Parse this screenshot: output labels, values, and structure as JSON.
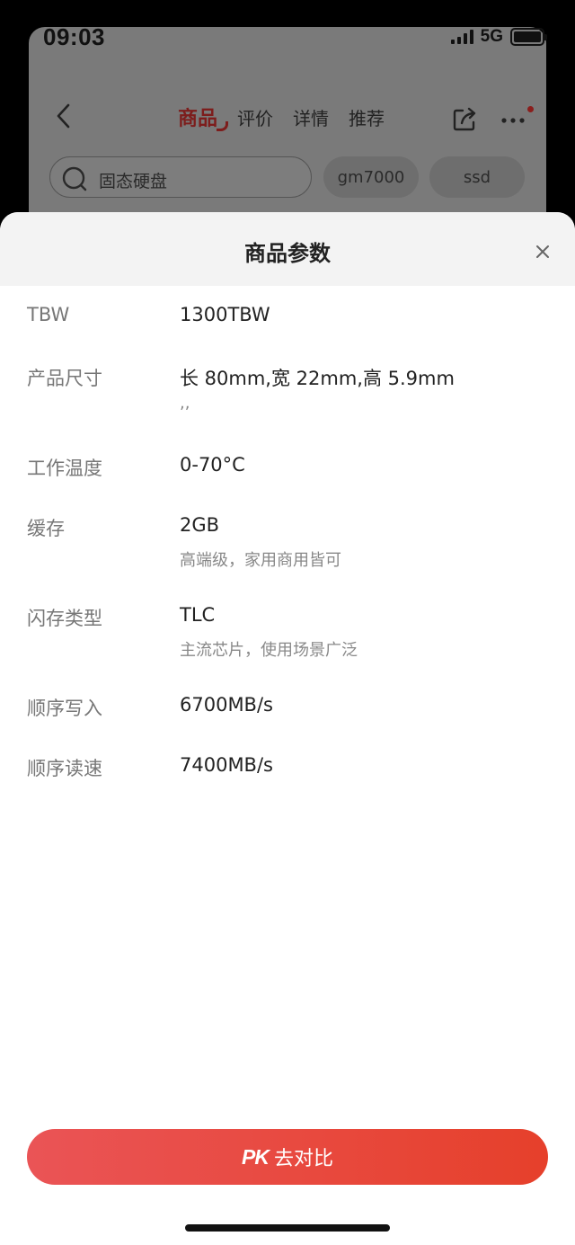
{
  "status_bar": {
    "time": "09:03",
    "network": "5G"
  },
  "background_page": {
    "tabs": [
      {
        "label": "商品",
        "active": true
      },
      {
        "label": "评价",
        "active": false
      },
      {
        "label": "详情",
        "active": false
      },
      {
        "label": "推荐",
        "active": false
      }
    ],
    "search": {
      "text": "固态硬盘"
    },
    "chips": [
      "gm7000",
      "ssd"
    ],
    "accent_color": "#7d1d1c"
  },
  "sheet": {
    "title": "商品参数",
    "params": [
      {
        "label": "TBW",
        "value": "1300TBW",
        "desc": ""
      },
      {
        "label": "产品尺寸",
        "value": "长 80mm,宽 22mm,高 5.9mm",
        "desc": ",,"
      },
      {
        "label": "工作温度",
        "value": "0-70°C",
        "desc": ""
      },
      {
        "label": "缓存",
        "value": "2GB",
        "desc": "高端级，家用商用皆可"
      },
      {
        "label": "闪存类型",
        "value": "TLC",
        "desc": "主流芯片，使用场景广泛"
      },
      {
        "label": "顺序写入",
        "value": "6700MB/s",
        "desc": ""
      },
      {
        "label": "顺序读速",
        "value": "7400MB/s",
        "desc": ""
      }
    ],
    "compare_button": {
      "logo": "PK",
      "label": "去对比"
    },
    "button_color": "#e6402b"
  }
}
